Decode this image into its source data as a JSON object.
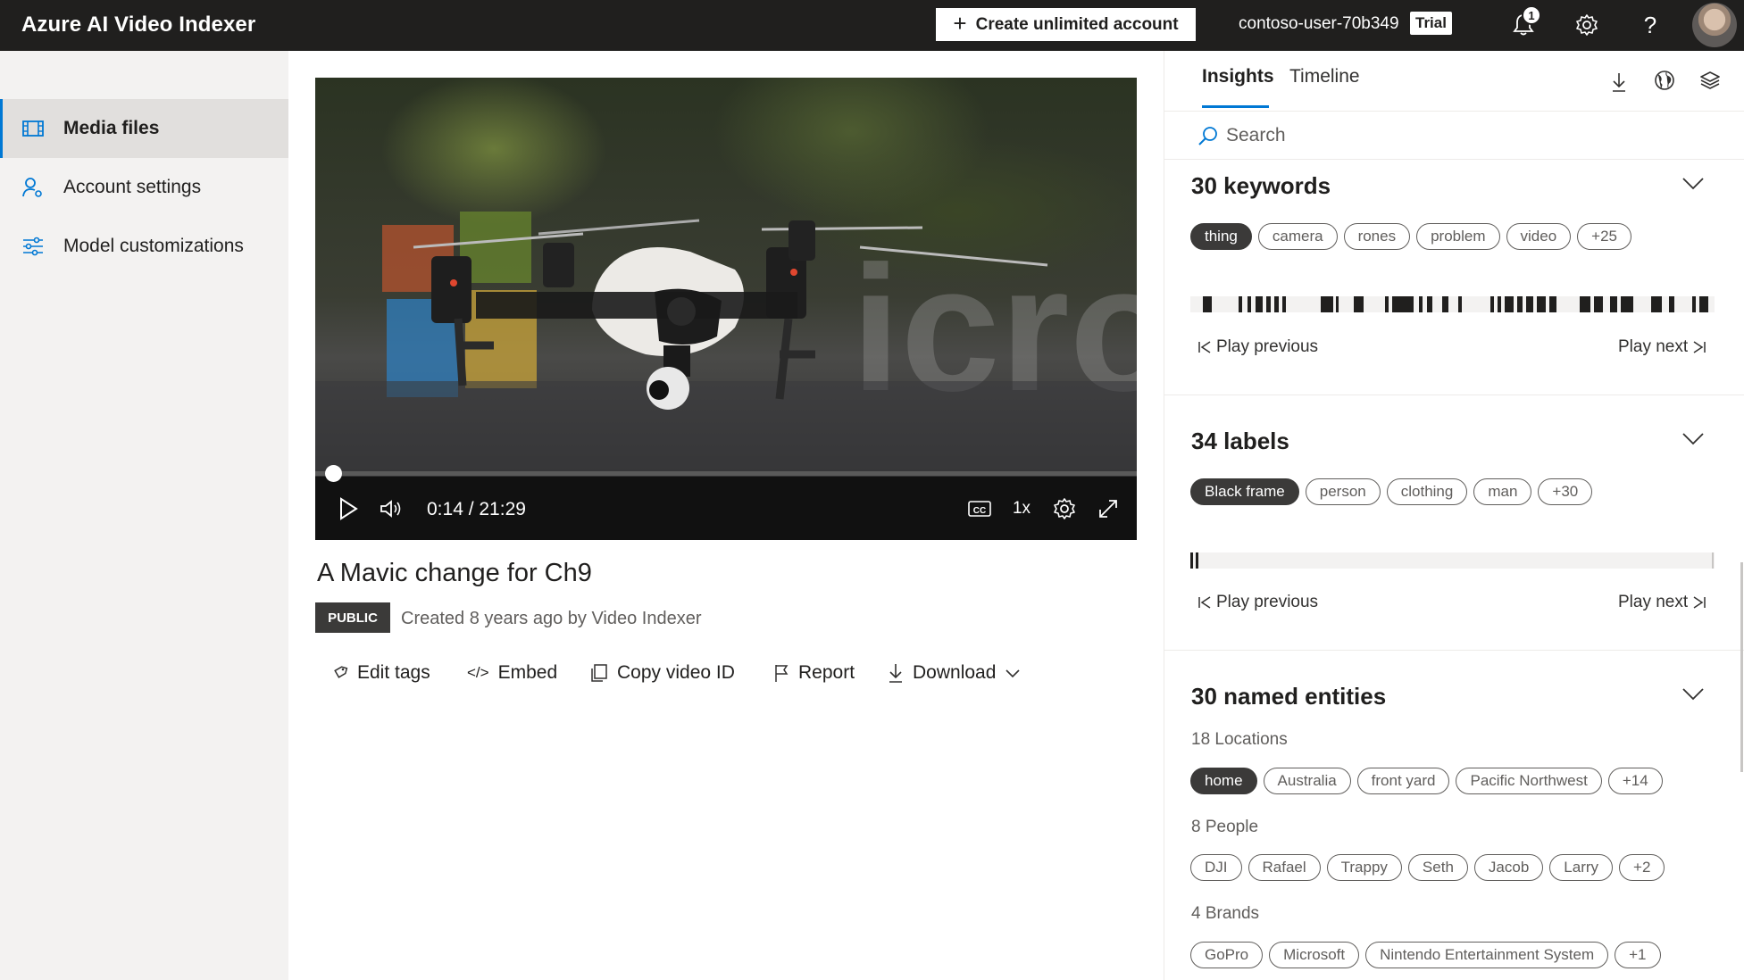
{
  "topbar": {
    "brand": "Azure AI Video Indexer",
    "create_button": "Create unlimited account",
    "user_name": "contoso-user-70b349",
    "trial_badge": "Trial",
    "notification_count": "1"
  },
  "sidebar": {
    "items": [
      {
        "label": "Media files",
        "icon": "film-icon",
        "active": true
      },
      {
        "label": "Account settings",
        "icon": "user-settings-icon",
        "active": false
      },
      {
        "label": "Model customizations",
        "icon": "sliders-icon",
        "active": false
      }
    ]
  },
  "player": {
    "time": "0:14 / 21:29",
    "speed": "1x",
    "progress": 0.011
  },
  "video": {
    "title": "A Mavic change for Ch9",
    "visibility": "PUBLIC",
    "created": "Created 8 years ago by Video Indexer"
  },
  "actions": {
    "edit_tags": "Edit tags",
    "embed": "Embed",
    "copy_id": "Copy video ID",
    "report": "Report",
    "download": "Download"
  },
  "panel": {
    "tabs": [
      "Insights",
      "Timeline"
    ],
    "search_placeholder": "Search",
    "play_previous": "Play previous",
    "play_next": "Play next",
    "keywords": {
      "title": "30 keywords",
      "pills": [
        "thing",
        "camera",
        "rones",
        "problem",
        "video",
        "+25"
      ]
    },
    "labels": {
      "title": "34 labels",
      "pills": [
        "Black frame",
        "person",
        "clothing",
        "man",
        "+30"
      ]
    },
    "entities": {
      "title": "30 named entities",
      "locations_heading": "18 Locations",
      "locations": [
        "home",
        "Australia",
        "front yard",
        "Pacific Northwest",
        "+14"
      ],
      "people_heading": "8 People",
      "people": [
        "DJI",
        "Rafael",
        "Trappy",
        "Seth",
        "Jacob",
        "Larry",
        "+2"
      ],
      "brands_heading": "4 Brands",
      "brands": [
        "GoPro",
        "Microsoft",
        "Nintendo Entertainment System",
        "+1"
      ]
    }
  },
  "colors": {
    "topbar": "#201f1e",
    "accent": "#0078d4",
    "sidebar": "#f3f2f1",
    "selected_pill": "#3b3a39"
  }
}
